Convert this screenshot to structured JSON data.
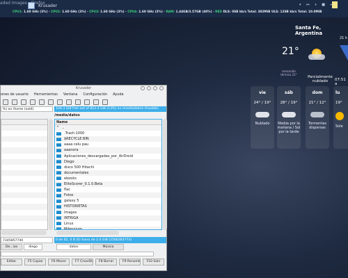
{
  "taskbar": {
    "prev_task": "aded Images - Firefox",
    "task": "Krusader",
    "sysmon": {
      "cpu1_label": "CPU1:",
      "cpu1": "1.60 GHz (3%)",
      "cpu2_label": "CPU2:",
      "cpu2": "1.60 GHz (3%)",
      "cpu3_label": "CPU3:",
      "cpu3": "1.60 GHz (3%)",
      "cpu4_label": "CPU4:",
      "cpu4": "1.60 GHz (3%)",
      "ram_label": "RAM:",
      "ram": "1.44GB/3.57GB (40%)",
      "red_label": "RED",
      "net": "DLS: 0SB  kb/s  Total: 382MiB  ULS: 12SB  kb/s  Total: 10.0MiB"
    }
  },
  "weather": {
    "city": "Santa Fe, Argentina",
    "temp": "21°",
    "feels": "sensación térmica 21°",
    "condition": "Parcialmente nublado",
    "wind_partial": "21 k",
    "time_partial": "07:51 a",
    "forecast": [
      {
        "day": "vie",
        "temps": "24° / 19°",
        "text": "Nublado"
      },
      {
        "day": "sáb",
        "temps": "28° / 19°",
        "text": "Niebla por la mañana / Sol por la tarde"
      },
      {
        "day": "dom",
        "temps": "21° / 12°",
        "text": "Tormentas dispersas"
      },
      {
        "day": "lu",
        "temps": "19°",
        "text": "Sole"
      }
    ]
  },
  "window": {
    "title": "Krusader",
    "menu": [
      "ones de usuario",
      "Herramientas",
      "Ventana",
      "Configuración",
      "Ayuda"
    ],
    "left_path": "%) on /home (ext4)",
    "right_path": "109.3 GiB free out of 812.4 GiB (13%) on /media/datos (fuseblk)",
    "right_header": "/media/datos",
    "col_name": "Name",
    "up": "..",
    "files": [
      ".Trash-1000",
      "$RECYCLE.BIN",
      "aaaa celu pau",
      "aaanora",
      "Aplicaciones_descargadas_por_AirDroid",
      "Diego",
      "disco 500 Hitachi",
      "documentales",
      "ebooks",
      "EliteScorer_0.1.0.Beta",
      "flac",
      "Fotos",
      "galaxy 5",
      "HISTORIETAS",
      "Images",
      "INTRIGA",
      "Linux",
      "Milennium"
    ],
    "left_status": "7345857740",
    "right_status": "0 de 62, 0 B (0) fuera de 2.4 GiB (2566283773)",
    "left_tabs": [
      "De...ias",
      "diego"
    ],
    "right_tabs": [
      "datos",
      "Música"
    ],
    "fkeys": [
      "Editar",
      "F5 Copiar",
      "F6 Mover",
      "F7 CrearDir",
      "F8 Borrar",
      "F9 Renombrar",
      "F10 Salir"
    ]
  }
}
